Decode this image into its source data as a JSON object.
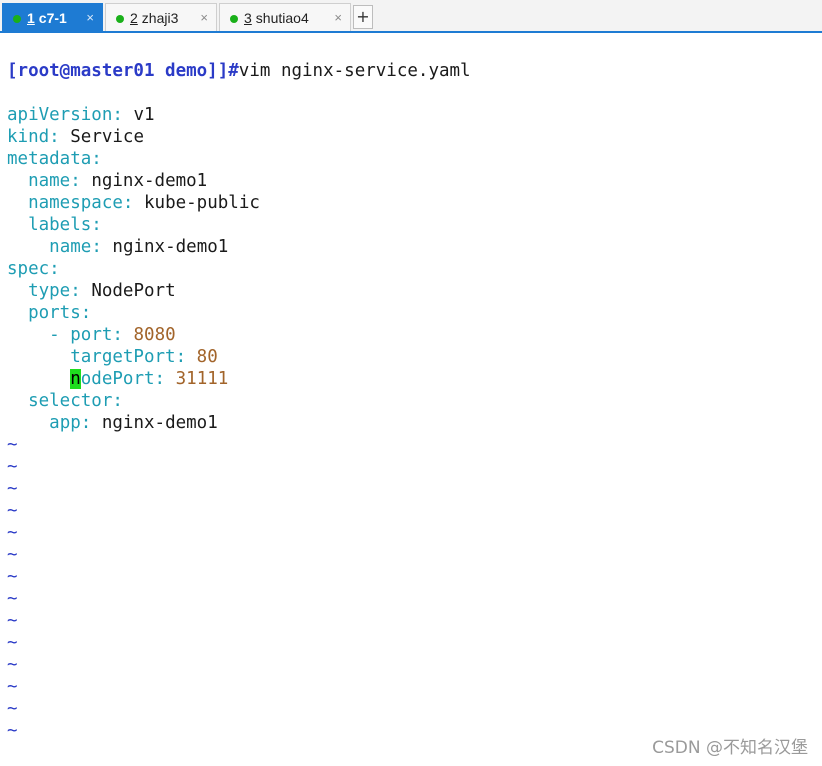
{
  "tabs": [
    {
      "num": "1",
      "label": "c7-1",
      "active": true,
      "close": "×"
    },
    {
      "num": "2",
      "label": "zhaji3",
      "active": false,
      "close": "×"
    },
    {
      "num": "3",
      "label": "shutiao4",
      "active": false,
      "close": "×"
    }
  ],
  "add_tab_label": "+",
  "terminal": {
    "prompt": "[root@master01 demo]]#",
    "command": "vim nginx-service.yaml",
    "yaml": {
      "apiVersion_key": "apiVersion",
      "apiVersion_val": "v1",
      "kind_key": "kind",
      "kind_val": "Service",
      "metadata_key": "metadata",
      "name_key": "name",
      "name_val": "nginx-demo1",
      "namespace_key": "namespace",
      "namespace_val": "kube-public",
      "labels_key": "labels",
      "labels_name_key": "name",
      "labels_name_val": "nginx-demo1",
      "spec_key": "spec",
      "type_key": "type",
      "type_val": "NodePort",
      "ports_key": "ports",
      "port_key": "port",
      "port_val": "8080",
      "targetPort_key": "targetPort",
      "targetPort_val": "80",
      "nodePort_cursor_char": "n",
      "nodePort_key_rest": "odePort",
      "nodePort_val": "31111",
      "selector_key": "selector",
      "app_key": "app",
      "app_val": "nginx-demo1",
      "colon": ":",
      "dash": "-"
    },
    "tilde": "~"
  },
  "watermark": "CSDN @不知名汉堡",
  "colors": {
    "tab_active": "#1e7bd3",
    "prompt": "#2b3bc7",
    "yaml_key": "#1e9db3",
    "yaml_number": "#a2642a",
    "cursor": "#1edd1e"
  }
}
